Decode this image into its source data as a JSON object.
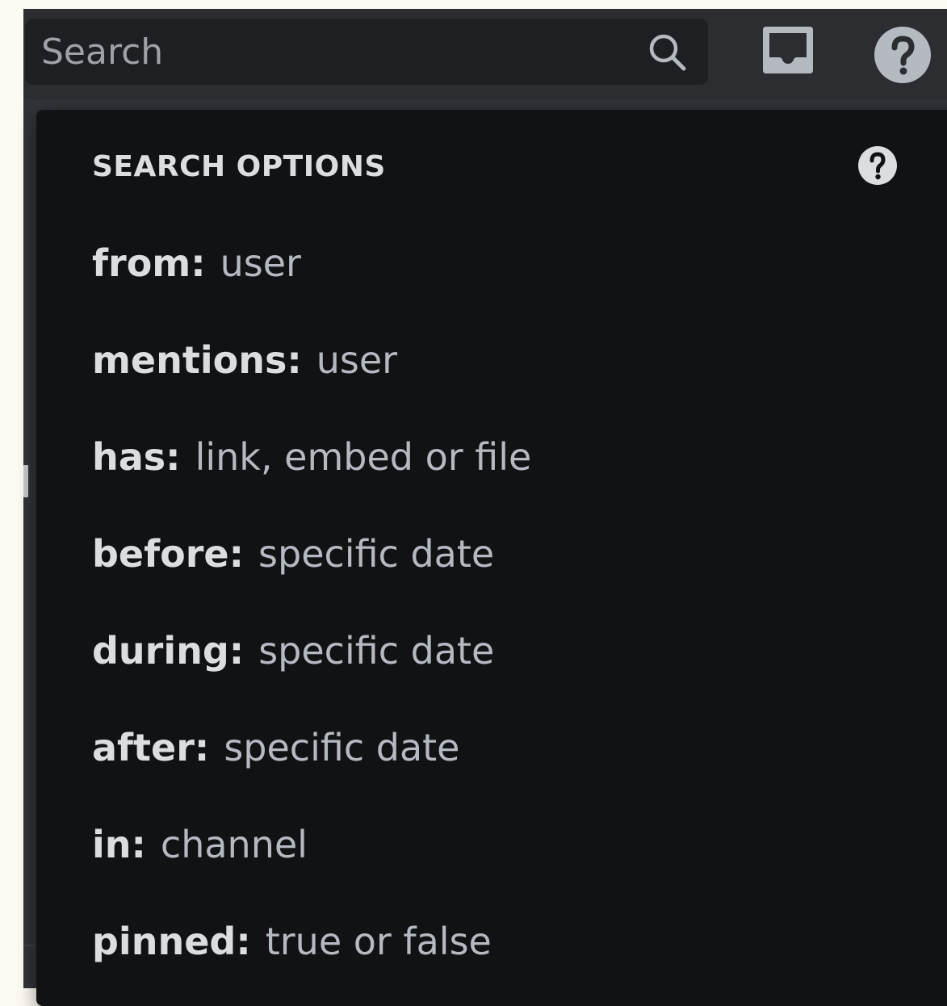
{
  "search": {
    "placeholder": "Search",
    "value": ""
  },
  "toolbar": {
    "search_icon": "search-icon",
    "inbox_icon": "inbox-icon",
    "help_icon": "help-icon"
  },
  "search_options": {
    "title": "SEARCH OPTIONS",
    "help_icon": "help-icon",
    "items": [
      {
        "key": "from:",
        "value": "user"
      },
      {
        "key": "mentions:",
        "value": "user"
      },
      {
        "key": "has:",
        "value": "link, embed or file"
      },
      {
        "key": "before:",
        "value": "specific date"
      },
      {
        "key": "during:",
        "value": "specific date"
      },
      {
        "key": "after:",
        "value": "specific date"
      },
      {
        "key": "in:",
        "value": "channel"
      },
      {
        "key": "pinned:",
        "value": "true or false"
      }
    ]
  },
  "colors": {
    "popup_background": "#111214",
    "topbar_background": "#2b2d31",
    "search_background": "#1e1f22",
    "key_text": "#dbdee1",
    "value_text": "#b5bac1",
    "icon": "#b5bac1",
    "page_background": "#fdfaf2"
  }
}
